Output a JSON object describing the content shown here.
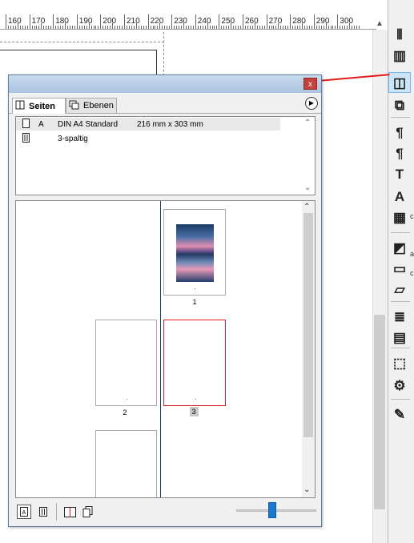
{
  "ruler": {
    "labels": [
      "160",
      "170",
      "180",
      "190",
      "200",
      "210",
      "220",
      "230",
      "240",
      "250",
      "260",
      "270",
      "280",
      "290",
      "300"
    ]
  },
  "palette": {
    "close_glyph": "x",
    "tabs": [
      {
        "label": "Seiten",
        "icon": "pages-icon"
      },
      {
        "label": "Ebenen",
        "icon": "layers-icon"
      }
    ],
    "menu_icon": "play-circle-icon",
    "masters": [
      {
        "prefix": "A",
        "name": "DIN A4 Standard",
        "size": "216 mm x 303 mm",
        "icon": "page-icon"
      },
      {
        "prefix": "",
        "name": "3-spaltig",
        "size": "",
        "icon": "columns-icon"
      }
    ],
    "pages": [
      {
        "number": "1",
        "has_image": true,
        "selected": false
      },
      {
        "number": "2",
        "has_image": false,
        "selected": false
      },
      {
        "number": "3",
        "has_image": false,
        "selected": true
      }
    ],
    "bottom_buttons": [
      "master-page-A-icon",
      "master-page-columns-icon",
      "facing-pages-icon",
      "single-page-icon"
    ],
    "zoom_fraction": 0.45
  },
  "toolbar": {
    "icons": [
      "column-guides-icon",
      "layout-icon",
      "pages-panel-icon",
      "layers-panel-icon",
      "paragraph-styles-icon",
      "paragraph-icon",
      "text-icon",
      "character-icon",
      "table-icon",
      "colors-icon",
      "frame-icon",
      "shape-icon",
      "text-wrap-icon",
      "align-icon",
      "transform-icon",
      "settings-icon",
      "edit-icon"
    ],
    "active": "pages-panel-icon",
    "accent": "#e21b1b"
  }
}
